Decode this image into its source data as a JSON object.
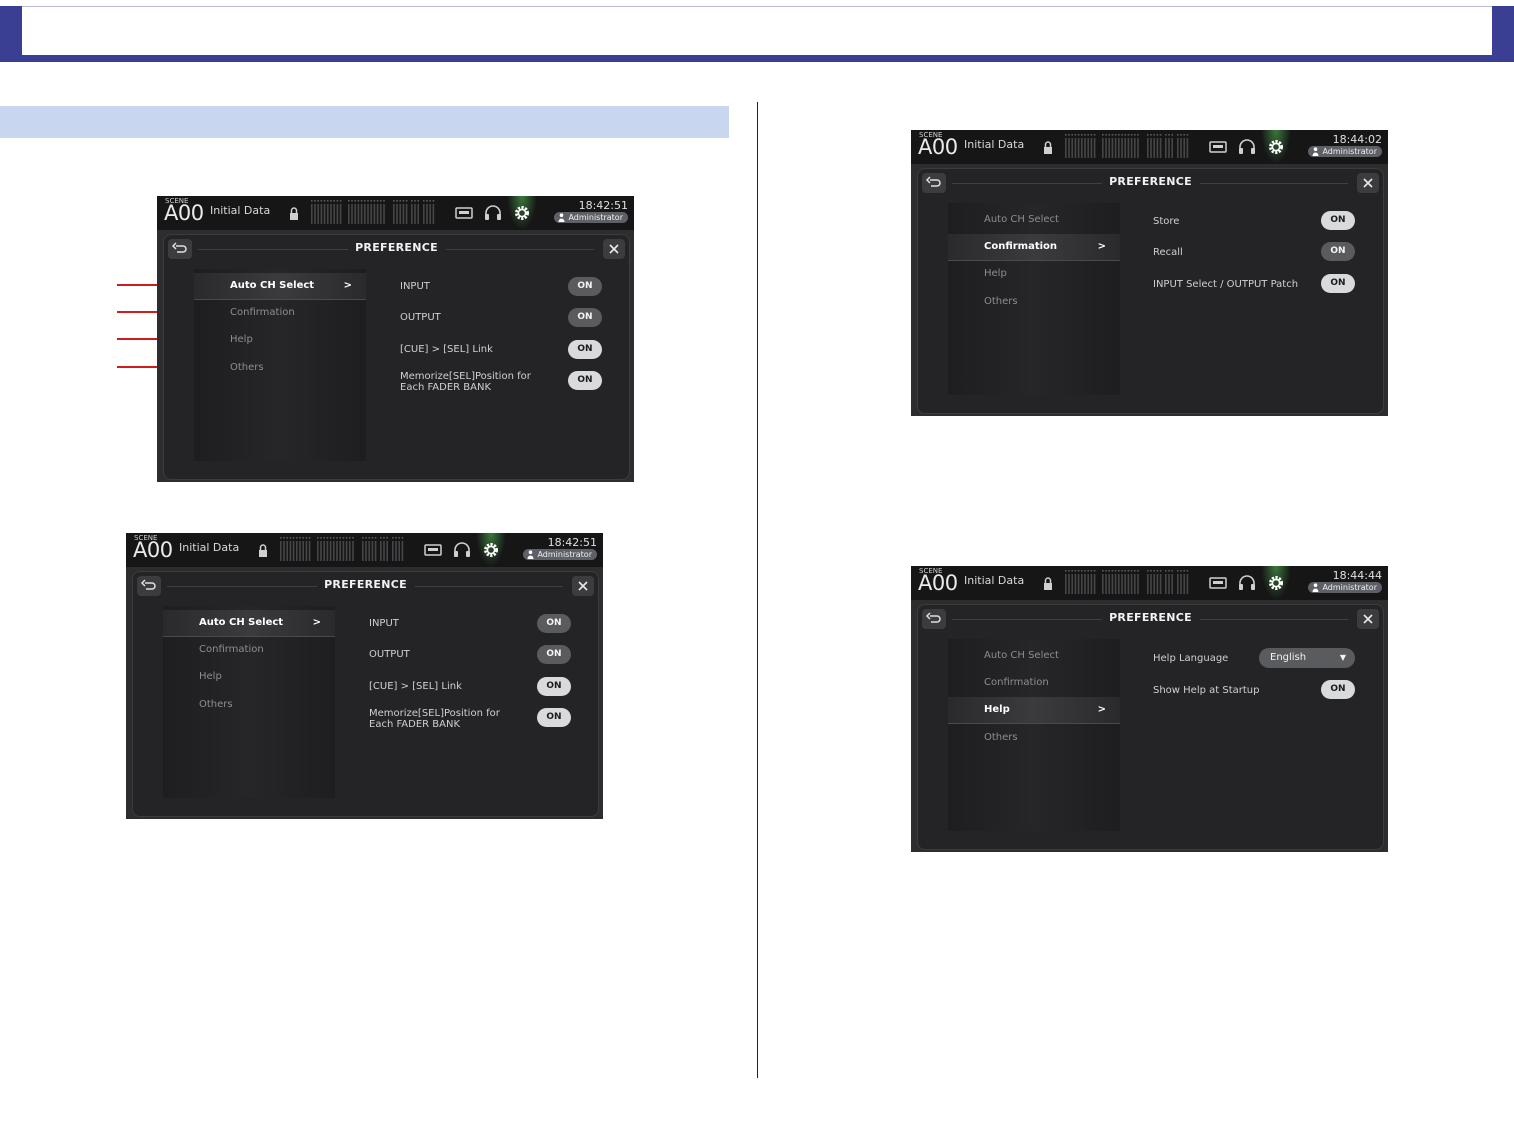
{
  "icons": {
    "lock": "lock-icon",
    "meter": "level-meter-icon",
    "recorder": "recorder-icon",
    "headphones": "headphones-icon",
    "gear": "gear-icon",
    "back": "back-arrow-icon",
    "close": "close-icon",
    "admin": "person-icon"
  },
  "colors": {
    "accent": "#3a3f93",
    "band": "#c8d6ef",
    "callout": "#cc1c1c",
    "glow": "#5ac85a"
  },
  "screens": [
    {
      "scene_label": "SCENE",
      "scene_number": "A00",
      "scene_name": "Initial Data",
      "time": "18:42:51",
      "user": "Administrator",
      "title": "PREFERENCE",
      "menu": [
        {
          "label": "Auto CH Select",
          "arrow": ">"
        },
        {
          "label": "Confirmation"
        },
        {
          "label": "Help"
        },
        {
          "label": "Others"
        }
      ],
      "settings": [
        {
          "label": "INPUT",
          "button": "ON"
        },
        {
          "label": "OUTPUT",
          "button": "ON"
        },
        {
          "label": "[CUE] > [SEL] Link",
          "button": "ON"
        },
        {
          "label": "Memorize[SEL]Position for",
          "label2": "Each FADER BANK",
          "button": "ON"
        }
      ]
    },
    {
      "scene_label": "SCENE",
      "scene_number": "A00",
      "scene_name": "Initial Data",
      "time": "18:42:51",
      "user": "Administrator",
      "title": "PREFERENCE",
      "menu": [
        {
          "label": "Auto CH Select",
          "arrow": ">"
        },
        {
          "label": "Confirmation"
        },
        {
          "label": "Help"
        },
        {
          "label": "Others"
        }
      ],
      "settings": [
        {
          "label": "INPUT",
          "button": "ON"
        },
        {
          "label": "OUTPUT",
          "button": "ON"
        },
        {
          "label": "[CUE] > [SEL] Link",
          "button": "ON"
        },
        {
          "label": "Memorize[SEL]Position for",
          "label2": "Each FADER BANK",
          "button": "ON"
        }
      ]
    },
    {
      "scene_label": "SCENE",
      "scene_number": "A00",
      "scene_name": "Initial Data",
      "time": "18:44:02",
      "user": "Administrator",
      "title": "PREFERENCE",
      "menu": [
        {
          "label": "Auto CH Select"
        },
        {
          "label": "Confirmation",
          "arrow": ">"
        },
        {
          "label": "Help"
        },
        {
          "label": "Others"
        }
      ],
      "settings": [
        {
          "label": "Store",
          "button": "ON"
        },
        {
          "label": "Recall",
          "button": "ON"
        },
        {
          "label": "INPUT Select / OUTPUT Patch",
          "button": "ON"
        }
      ]
    },
    {
      "scene_label": "SCENE",
      "scene_number": "A00",
      "scene_name": "Initial Data",
      "time": "18:44:44",
      "user": "Administrator",
      "title": "PREFERENCE",
      "menu": [
        {
          "label": "Auto CH Select"
        },
        {
          "label": "Confirmation"
        },
        {
          "label": "Help",
          "arrow": ">"
        },
        {
          "label": "Others"
        }
      ],
      "settings": [
        {
          "label": "Help Language",
          "dropdown": "English"
        },
        {
          "label": "Show Help at Startup",
          "button": "ON"
        }
      ]
    }
  ]
}
